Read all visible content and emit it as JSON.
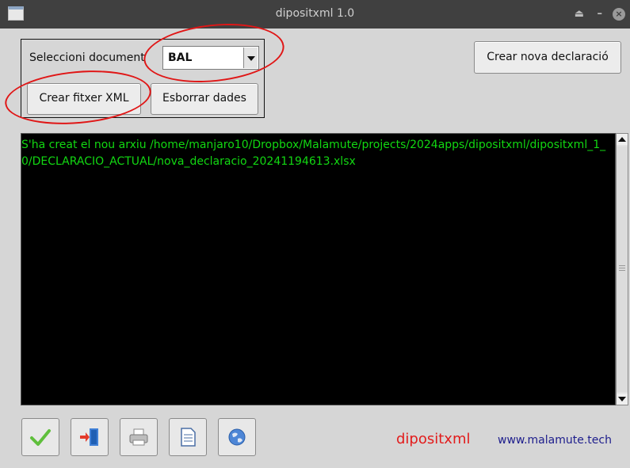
{
  "window": {
    "title": "dipositxml 1.0",
    "close_glyph": "×"
  },
  "form": {
    "select_label": "Seleccioni document",
    "select_value": "BAL",
    "create_xml_button": "Crear fitxer XML",
    "clear_button": "Esborrar dades",
    "new_declaration_button": "Crear nova declaració"
  },
  "output": {
    "text": "S'ha creat el nou arxiu /home/manjaro10/Dropbox/Malamute/projects/2024apps/dipositxml/dipositxml_1_0/DECLARACIO_ACTUAL/nova_declaracio_20241194613.xlsx",
    "text_color": "#12d812"
  },
  "toolbar": {
    "icons": [
      "checkmark-icon",
      "exit-door-icon",
      "printer-icon",
      "document-icon",
      "globe-icon"
    ]
  },
  "footer": {
    "brand": "dipositxml",
    "website": "www.malamute.tech",
    "brand_color": "#e21c1c",
    "website_color": "#1d1d8c"
  },
  "annotations": {
    "color": "#e01616"
  }
}
